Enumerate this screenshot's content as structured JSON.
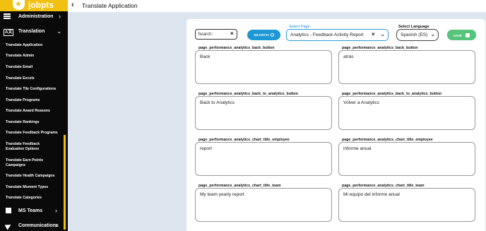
{
  "brand": {
    "logo_text": "jobpts"
  },
  "sidebar": {
    "administration": "Administration",
    "translation": "Translation",
    "sub_items": [
      "Translate Application",
      "Translate Admin",
      "Translate Email",
      "Translate Excels",
      "Translate Tile Configurations",
      "Translate Programs",
      "Translate Award Reasons",
      "Translate Rankings",
      "Translate Feedback Programs",
      "Translate Feedback Evaluation Options",
      "Translate Earn Points Campaigns",
      "Translate Health Campaigns",
      "Translate Moment Types",
      "Translate Categories"
    ],
    "ms_teams": "MS Teams",
    "communications": "Communications"
  },
  "header": {
    "title": "Translate Application"
  },
  "toolbar": {
    "search_placeholder": "Search:",
    "search_button": "SEARCH",
    "select_page_label": "Select Page",
    "select_page_value": "Analytics - Feedback Activity Report",
    "select_language_label": "Select Language",
    "select_language_value": "Spanish (ES)",
    "save_button": "SAVE"
  },
  "fields": [
    {
      "key": "page_performance_analytics_back_button",
      "source": "Back",
      "translation": "atrás"
    },
    {
      "key": "page_performance_analytics_back_to_analytics_button",
      "source": "Back to Analytics",
      "translation": "Volver a Analytics"
    },
    {
      "key": "page_performance_analytics_chart_title_employee",
      "source": "report",
      "translation": "informe anual"
    },
    {
      "key": "page_performance_analytics_chart_title_team",
      "source": "My team yearly report",
      "translation": "Mi equipo del informe anual"
    }
  ],
  "colors": {
    "brand_yellow": "#f2c011",
    "accent_blue": "#1d98d6",
    "save_green": "#56c47a",
    "sidebar_bg": "#0a0a0a"
  }
}
